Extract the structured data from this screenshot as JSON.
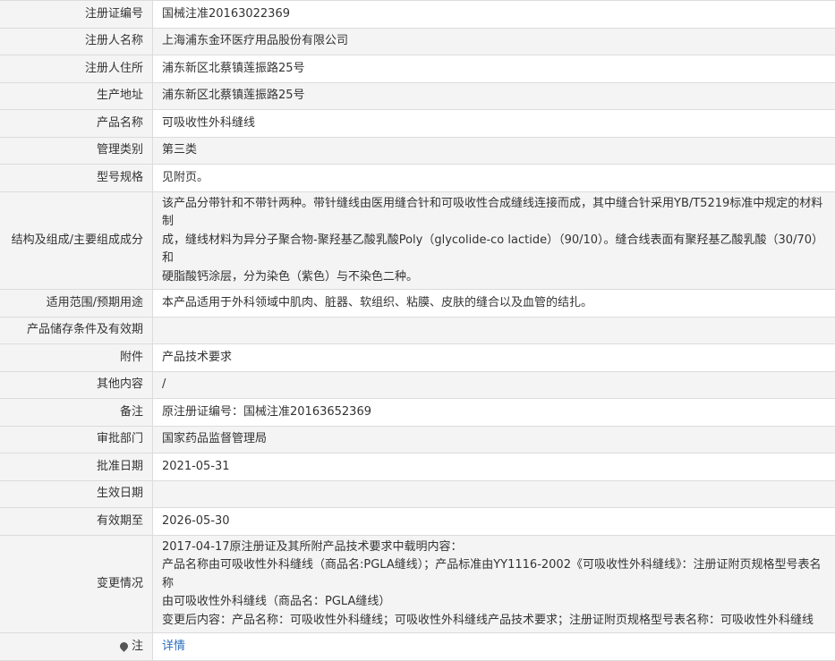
{
  "rows": [
    {
      "label": "注册证编号",
      "value": "国械注准20163022369"
    },
    {
      "label": "注册人名称",
      "value": "上海浦东金环医疗用品股份有限公司"
    },
    {
      "label": "注册人住所",
      "value": "浦东新区北蔡镇莲振路25号"
    },
    {
      "label": "生产地址",
      "value": "浦东新区北蔡镇莲振路25号"
    },
    {
      "label": "产品名称",
      "value": "可吸收性外科缝线"
    },
    {
      "label": "管理类别",
      "value": "第三类"
    },
    {
      "label": "型号规格",
      "value": "见附页。"
    },
    {
      "label": "结构及组成/主要组成成分",
      "lines": [
        "该产品分带针和不带针两种。带针缝线由医用缝合针和可吸收性合成缝线连接而成，其中缝合针采用YB/T5219标准中规定的材料制",
        "成，缝线材料为异分子聚合物-聚羟基乙酸乳酸Poly（glycolide-co lactide）（90/10）。缝合线表面有聚羟基乙酸乳酸（30/70）和",
        "硬脂酸钙涂层，分为染色（紫色）与不染色二种。"
      ]
    },
    {
      "label": "适用范围/预期用途",
      "value": "本产品适用于外科领域中肌肉、脏器、软组织、粘膜、皮肤的缝合以及血管的结扎。"
    },
    {
      "label": "产品储存条件及有效期",
      "value": ""
    },
    {
      "label": "附件",
      "value": "产品技术要求"
    },
    {
      "label": "其他内容",
      "value": "/"
    },
    {
      "label": "备注",
      "value": "原注册证编号：国械注准20163652369"
    },
    {
      "label": "审批部门",
      "value": "国家药品监督管理局"
    },
    {
      "label": "批准日期",
      "value": "2021-05-31"
    },
    {
      "label": "生效日期",
      "value": ""
    },
    {
      "label": "有效期至",
      "value": "2026-05-30"
    },
    {
      "label": "变更情况",
      "lines": [
        "2017-04-17原注册证及其所附产品技术要求中载明内容：",
        "产品名称由可吸收性外科缝线（商品名:PGLA缝线）；产品标准由YY1116-2002《可吸收性外科缝线》：注册证附页规格型号表名称",
        "由可吸收性外科缝线（商品名：PGLA缝线）",
        "变更后内容：产品名称：可吸收性外科缝线；可吸收性外科缝线产品技术要求；注册证附页规格型号表名称：可吸收性外科缝线"
      ]
    },
    {
      "label": "注",
      "value": "详情"
    }
  ]
}
